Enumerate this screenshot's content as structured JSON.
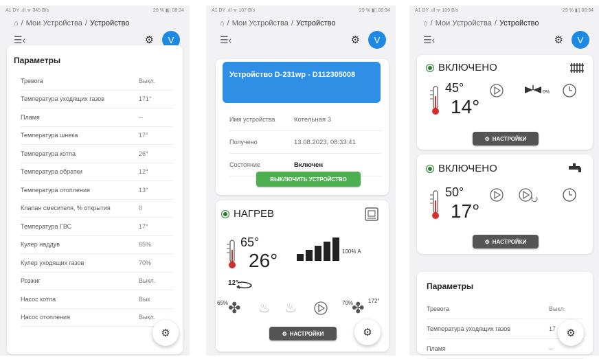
{
  "screens": [
    {
      "status_left": "A1 DY .ıll ᯤ 345 B/s",
      "status_right": "29 % ▮▯ 08:34",
      "breadcrumb": [
        "Мои Устройства",
        "Устройство"
      ],
      "avatar": "V",
      "params_title": "Параметры",
      "params": [
        {
          "k": "Тревога",
          "v": "Выкл."
        },
        {
          "k": "Температура уходящих газов",
          "v": "171°"
        },
        {
          "k": "Пламя",
          "v": "--"
        },
        {
          "k": "Температура шнека",
          "v": "17°"
        },
        {
          "k": "Температура котла",
          "v": "26°"
        },
        {
          "k": "Температура обратки",
          "v": "12°"
        },
        {
          "k": "Температура отопления",
          "v": "13°"
        },
        {
          "k": "Клапан смесителя, % открытия",
          "v": "0"
        },
        {
          "k": "Температура ГВС",
          "v": "17°"
        },
        {
          "k": "Кулер наддув",
          "v": "65%"
        },
        {
          "k": "Кулер уходящих газов",
          "v": "70%"
        },
        {
          "k": "Розжиг",
          "v": "Выкл."
        },
        {
          "k": "Насос котла",
          "v": "Вык"
        },
        {
          "k": "Насос отопления",
          "v": "Выкл."
        }
      ]
    },
    {
      "status_left": "A1 DY .ıll ᯤ 107 B/s",
      "status_right": "29 % ▮▯ 08:34",
      "breadcrumb": [
        "Мои Устройства",
        "Устройство"
      ],
      "avatar": "V",
      "device_title": "Устройство D-231wp - D112305008",
      "device_rows": [
        {
          "k": "Имя устройства",
          "v": "Котельная 3"
        },
        {
          "k": "Получено",
          "v": "13.08.2023, 08:33:41"
        },
        {
          "k": "Состояние",
          "v": "Включен"
        }
      ],
      "off_button": "ВЫКЛЮЧИТЬ УСТРОЙСТВО",
      "heat_status": "НАГРЕВ",
      "heat_top_temp": "65°",
      "heat_big_temp": "26°",
      "power_label": "100% A",
      "small_temp": "12°",
      "fan_left": "65%",
      "fan_right": "70%",
      "fan_right_temp": "172°",
      "settings": "НАСТРОЙКИ"
    },
    {
      "status_left": "A1 DY .ıll ᯤ 109 B/s",
      "status_right": "29 % ▮▯ 08:34",
      "breadcrumb": [
        "Мои Устройства",
        "Устройство"
      ],
      "avatar": "V",
      "circuit1": {
        "status": "ВКЛЮЧЕНО",
        "top": "45°",
        "big": "14°",
        "valve": "0%"
      },
      "circuit2": {
        "status": "ВКЛЮЧЕНО",
        "top": "50°",
        "big": "17°"
      },
      "settings": "НАСТРОЙКИ",
      "params_title": "Параметры",
      "params": [
        {
          "k": "Тревога",
          "v": "Выкл."
        },
        {
          "k": "Температура уходящих газов",
          "v": "17"
        },
        {
          "k": "Пламя",
          "v": "--"
        }
      ]
    }
  ],
  "colors": {
    "accent": "#1e88e5",
    "device_card": "#2f8fe4",
    "green": "#4caf50",
    "dark_btn": "#555555"
  }
}
